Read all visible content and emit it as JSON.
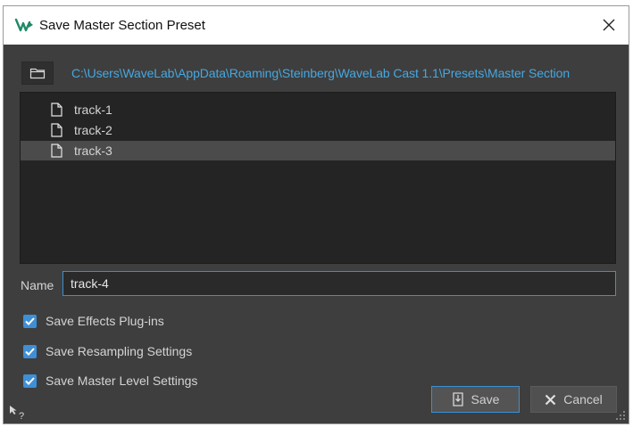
{
  "window": {
    "title": "Save Master Section Preset",
    "accent_color": "#3e8fd6",
    "path_color": "#46a7e0"
  },
  "path": {
    "text": "C:\\Users\\WaveLab\\AppData\\Roaming\\Steinberg\\WaveLab Cast 1.1\\Presets\\Master Section"
  },
  "files": [
    {
      "label": "track-1",
      "selected": false
    },
    {
      "label": "track-2",
      "selected": false
    },
    {
      "label": "track-3",
      "selected": true
    }
  ],
  "name": {
    "label": "Name",
    "value": "track-4"
  },
  "options": [
    {
      "label": "Save Effects Plug-ins",
      "checked": true
    },
    {
      "label": "Save Resampling Settings",
      "checked": true
    },
    {
      "label": "Save Master Level Settings",
      "checked": true
    }
  ],
  "buttons": {
    "save_label": "Save",
    "cancel_label": "Cancel"
  },
  "icons": [
    "app-logo-icon",
    "close-icon",
    "folder-icon",
    "file-icon",
    "checkmark-icon",
    "save-icon",
    "cancel-x-icon",
    "help-cursor-icon",
    "resize-grip-icon"
  ]
}
